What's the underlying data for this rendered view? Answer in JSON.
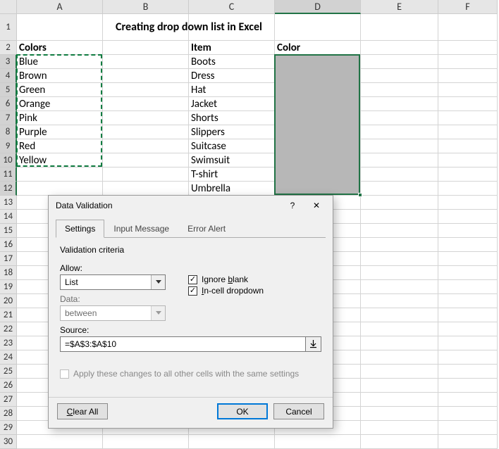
{
  "columns": [
    "A",
    "B",
    "C",
    "D",
    "E",
    "F"
  ],
  "active_column": "D",
  "row_count": 30,
  "title_cell": "Creating drop down list in Excel",
  "headers": {
    "A2": "Colors",
    "C2": "Item",
    "D2": "Color"
  },
  "colA": [
    "Blue",
    "Brown",
    "Green",
    "Orange",
    "Pink",
    "Purple",
    "Red",
    "Yellow"
  ],
  "colC": [
    "Boots",
    "Dress",
    "Hat",
    "Jacket",
    "Shorts",
    "Slippers",
    "Suitcase",
    "Swimsuit",
    "T-shirt",
    "Umbrella"
  ],
  "ants_range": "A3:A10",
  "selection_range": "D3:D12",
  "dialog": {
    "title": "Data Validation",
    "help_icon": "?",
    "close_icon": "✕",
    "tabs": [
      "Settings",
      "Input Message",
      "Error Alert"
    ],
    "active_tab": 0,
    "legend": "Validation criteria",
    "allow_label": "Allow:",
    "allow_value": "List",
    "data_label": "Data:",
    "data_value": "between",
    "ignore_blank_label_pre": "Ignore ",
    "ignore_blank_label_u": "b",
    "ignore_blank_label_post": "lank",
    "ignore_blank_checked": true,
    "incell_label_u": "I",
    "incell_label_post": "n-cell dropdown",
    "incell_checked": true,
    "source_label": "Source:",
    "source_value": "=$A$3:$A$10",
    "apply_label_u": "",
    "apply_label": "Apply these changes to all other cells with the same settings",
    "apply_checked": false,
    "clear_all_u": "C",
    "clear_all_post": "lear All",
    "ok": "OK",
    "cancel": "Cancel"
  },
  "chart_data": {
    "type": "table",
    "title": "Creating drop down list in Excel",
    "columns": [
      "Colors",
      "Item",
      "Color"
    ],
    "Colors": [
      "Blue",
      "Brown",
      "Green",
      "Orange",
      "Pink",
      "Purple",
      "Red",
      "Yellow"
    ],
    "Item": [
      "Boots",
      "Dress",
      "Hat",
      "Jacket",
      "Shorts",
      "Slippers",
      "Suitcase",
      "Swimsuit",
      "T-shirt",
      "Umbrella"
    ],
    "Color": [
      "",
      "",
      "",
      "",
      "",
      "",
      "",
      "",
      "",
      ""
    ]
  }
}
